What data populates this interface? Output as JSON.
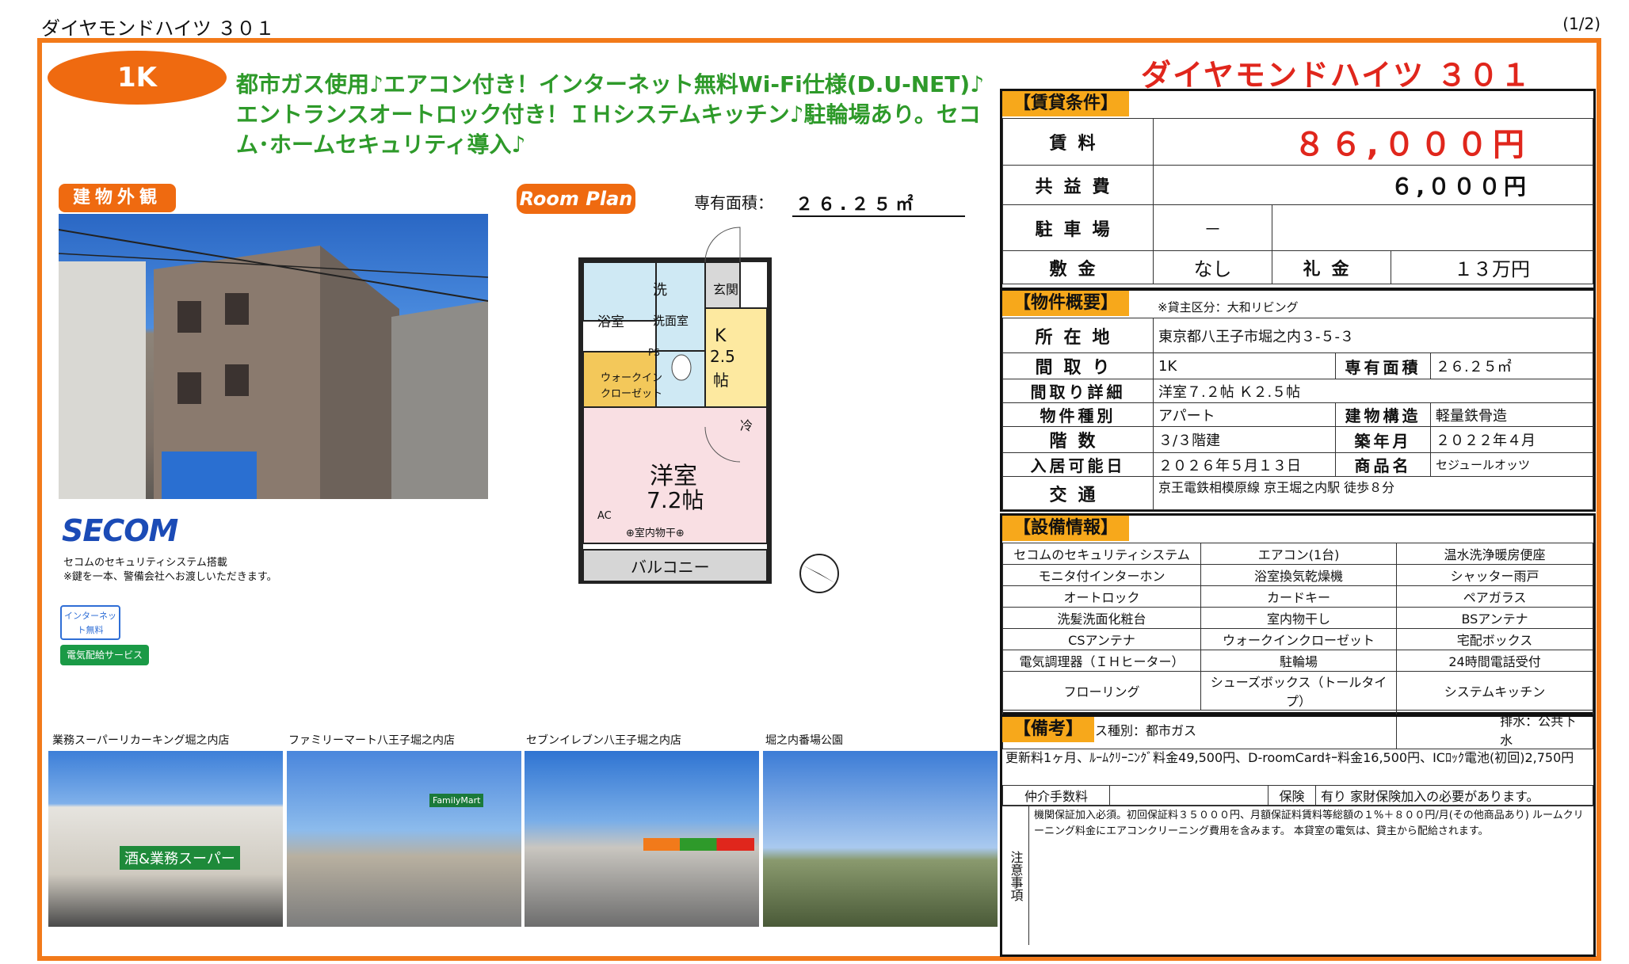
{
  "header": {
    "title": "ダイヤモンドハイツ ３０１",
    "page": "(1/2)"
  },
  "left": {
    "badge": "1K",
    "catchcopy": "都市ガス使用♪エアコン付き！インターネット無料Wi-Fi仕様(D.U-NET)♪エントランスオートロック付き！ＩＨシステムキッチン♪駐輪場あり。セコム･ホームセキュリティ導入♪",
    "exterior_tag": "建物外観",
    "plan_tag": "Room Plan",
    "area_label": "専有面積：",
    "area_value": "２６.２５㎡",
    "secom_logo": "SECOM",
    "secom_note1": "セコムのセキュリティシステム搭載",
    "secom_note2": "※鍵を一本、警備会社へお渡しいただきます。",
    "net_badge": "インターネット無料",
    "elec_badge": "電気配給サービス",
    "floorplan": {
      "bath": "浴室",
      "wash": "洗",
      "washroom": "洗面室",
      "entrance": "玄関",
      "kitchen": "K",
      "kitchen_size": "2.5",
      "kitchen_unit": "帖",
      "ps": "PS",
      "wic1": "ウォークイン",
      "wic2": "クローゼット",
      "fridge": "冷",
      "room": "洋室",
      "room_size": "7.2帖",
      "ac": "AC",
      "drying": "⊕室内物干⊕",
      "balcony": "バルコニー"
    },
    "neighborhood": [
      {
        "name": "業務スーパーリカーキング堀之内店",
        "sign": "酒&業務スーパー"
      },
      {
        "name": "ファミリーマート八王子堀之内店",
        "sign": "FamilyMart"
      },
      {
        "name": "セブンイレブン八王子堀之内店",
        "sign": ""
      },
      {
        "name": "堀之内番場公園",
        "sign": ""
      }
    ]
  },
  "right": {
    "property_name": "ダイヤモンドハイツ ３０１",
    "rent_section": "【賃貸条件】",
    "rent_label": "賃料",
    "rent_value": "８６,０００円",
    "common_label": "共益費",
    "common_value": "６,０００円",
    "parking_label": "駐車場",
    "parking_value": "－",
    "deposit_label": "敷金",
    "deposit_value": "なし",
    "key_money_label": "礼金",
    "key_money_value": "１３万円",
    "overview_section": "【物件概要】",
    "overview_note": "※貸主区分：大和リビング",
    "address_label": "所在地",
    "address_value": "東京都八王子市堀之内３-５-３",
    "layout_label": "間取り",
    "layout_value": "1K",
    "area_label": "専有面積",
    "area_value": "２６.２５㎡",
    "layout_detail_label": "間取り詳細",
    "layout_detail_value": "洋室７.２帖 Ｋ２.５帖",
    "type_label": "物件種別",
    "type_value": "アパート",
    "structure_label": "建物構造",
    "structure_value": "軽量鉄骨造",
    "floors_label": "階数",
    "floors_value": "３/３階建",
    "built_label": "築年月",
    "built_value": "２０２２年４月",
    "movein_label": "入居可能日",
    "movein_value": "２０２６年５月１３日",
    "product_label": "商品名",
    "product_value": "セジュールオッツ",
    "access_label": "交通",
    "access_value": "京王電鉄相模原線 京王堀之内駅 徒歩８分",
    "equipment_section": "【設備情報】",
    "equipment": [
      [
        "セコムのセキュリティシステム",
        "エアコン(1台)",
        "温水洗浄暖房便座"
      ],
      [
        "モニタ付インターホン",
        "浴室換気乾燥機",
        "シャッター雨戸"
      ],
      [
        "オートロック",
        "カードキー",
        "ペアガラス"
      ],
      [
        "洗髪洗面化粧台",
        "室内物干し",
        "BSアンテナ"
      ],
      [
        "CSアンテナ",
        "ウォークインクローゼット",
        "宅配ボックス"
      ],
      [
        "電気調理器（ＩＨヒーター）",
        "駐輪場",
        "24時間電話受付"
      ],
      [
        "フローリング",
        "シューズボックス（トールタイプ）",
        "システムキッチン"
      ]
    ],
    "gas": "ガス種別：都市ガス",
    "drain": "排水：公共下水",
    "remarks_section": "【備考】",
    "remarks_text": "更新料1ヶ月、ﾙｰﾑｸﾘｰﾆﾝｸﾞ料金49,500円、D-roomCardｷｰ料金16,500円、ICﾛｯｸ電池(初回)2,750円",
    "broker_label": "仲介手数料",
    "insurance_label": "保険",
    "insurance_value": "有り 家財保険加入の必要があります。",
    "caution_label": "注意事項",
    "caution_text": "機関保証加入必須。初回保証料３５０００円、月額保証料賃料等総額の１%＋８００円/月(その他商品あり) ルームクリーニング料金にエアコンクリーニング費用を含みます。 本貸室の電気は、貸主から配給されます。"
  },
  "colors": {
    "orange": "#ef6a10",
    "green": "#2e9a2a",
    "red": "#e0261c",
    "section": "#f7a81b"
  }
}
